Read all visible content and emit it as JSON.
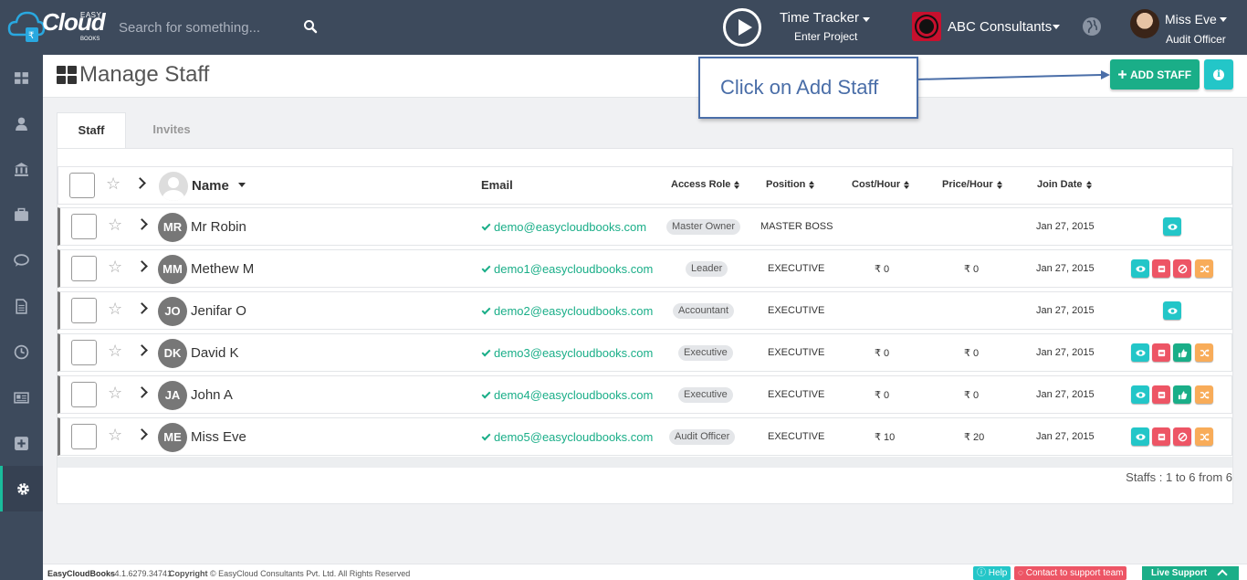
{
  "brand": {
    "easy": "EASY",
    "cloud": "Cloud",
    "books": "BOOKS"
  },
  "search": {
    "placeholder": "Search for something..."
  },
  "time_tracker": {
    "title": "Time Tracker",
    "subtitle": "Enter Project"
  },
  "company": {
    "name": "ABC Consultants"
  },
  "user": {
    "name": "Miss Eve",
    "role": "Audit Officer"
  },
  "sidebar": {
    "items": [
      {
        "icon": "dashboard-icon"
      },
      {
        "icon": "user-icon"
      },
      {
        "icon": "bank-icon"
      },
      {
        "icon": "briefcase-icon"
      },
      {
        "icon": "chat-icon"
      },
      {
        "icon": "document-icon"
      },
      {
        "icon": "clock-icon"
      },
      {
        "icon": "newspaper-icon"
      },
      {
        "icon": "plus-square-icon"
      },
      {
        "icon": "gear-icon",
        "active": true
      }
    ]
  },
  "page": {
    "title": "Manage Staff"
  },
  "callout": {
    "text": "Click on Add Staff"
  },
  "actions": {
    "add_staff_label": "ADD STAFF"
  },
  "tabs": [
    {
      "label": "Staff",
      "active": true
    },
    {
      "label": "Invites",
      "active": false
    }
  ],
  "table": {
    "headers": {
      "name": "Name",
      "email": "Email",
      "access_role": "Access Role",
      "position": "Position",
      "cost_hour": "Cost/Hour",
      "price_hour": "Price/Hour",
      "join_date": "Join Date"
    },
    "rows": [
      {
        "initials": "MR",
        "name": "Mr Robin",
        "email": "demo@easycloudbooks.com",
        "role": "Master Owner",
        "position": "MASTER BOSS",
        "cost": "",
        "price": "",
        "join": "Jan 27, 2015",
        "actions": [
          "view"
        ]
      },
      {
        "initials": "MM",
        "name": "Methew M",
        "email": "demo1@easycloudbooks.com",
        "role": "Leader",
        "position": "EXECUTIVE",
        "cost": "₹ 0",
        "price": "₹ 0",
        "join": "Jan 27, 2015",
        "actions": [
          "view",
          "delete",
          "block",
          "transfer"
        ]
      },
      {
        "initials": "JO",
        "name": "Jenifar O",
        "email": "demo2@easycloudbooks.com",
        "role": "Accountant",
        "position": "EXECUTIVE",
        "cost": "",
        "price": "",
        "join": "Jan 27, 2015",
        "actions": [
          "view"
        ]
      },
      {
        "initials": "DK",
        "name": "David K",
        "email": "demo3@easycloudbooks.com",
        "role": "Executive",
        "position": "EXECUTIVE",
        "cost": "₹ 0",
        "price": "₹ 0",
        "join": "Jan 27, 2015",
        "actions": [
          "view",
          "delete",
          "approve",
          "transfer"
        ]
      },
      {
        "initials": "JA",
        "name": "John A",
        "email": "demo4@easycloudbooks.com",
        "role": "Executive",
        "position": "EXECUTIVE",
        "cost": "₹ 0",
        "price": "₹ 0",
        "join": "Jan 27, 2015",
        "actions": [
          "view",
          "delete",
          "approve",
          "transfer"
        ]
      },
      {
        "initials": "ME",
        "name": "Miss Eve",
        "email": "demo5@easycloudbooks.com",
        "role": "Audit Officer",
        "position": "EXECUTIVE",
        "cost": "₹ 10",
        "price": "₹ 20",
        "join": "Jan 27, 2015",
        "actions": [
          "view",
          "delete",
          "block",
          "transfer"
        ]
      }
    ],
    "pager": "Staffs : 1 to 6 from 6"
  },
  "footer": {
    "brand": "EasyCloudBooks",
    "version": "· 4.1.6279.34741",
    "copyright_label": "Copyright",
    "copyright_text": "© EasyCloud Consultants Pvt. Ltd. All Rights Reserved",
    "help": "Help",
    "contact": "Contact to support team",
    "live_support": "Live Support"
  },
  "colors": {
    "topbar": "#3d4a5c",
    "accent_green": "#1aae88",
    "accent_teal": "#23c6c8",
    "danger": "#ed5565",
    "warning": "#f8ac59",
    "callout_blue": "#4a6ea8"
  }
}
